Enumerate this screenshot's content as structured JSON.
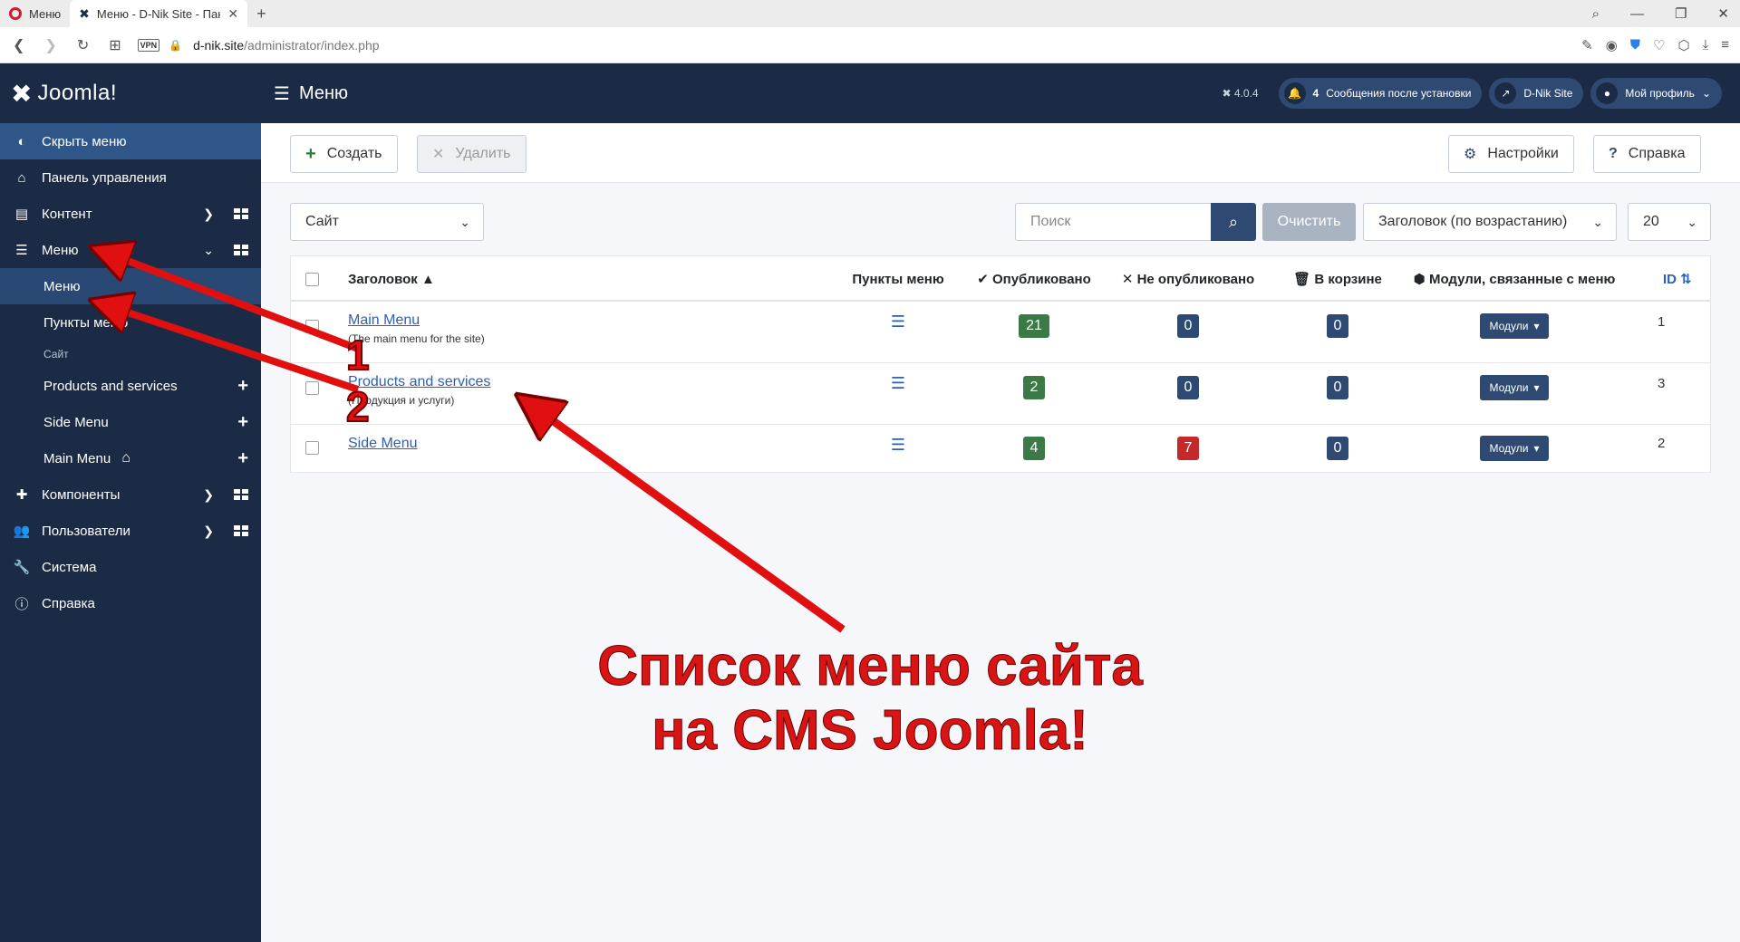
{
  "browser": {
    "tabs": [
      {
        "label": "Меню",
        "icon": "opera-icon"
      },
      {
        "label": "Меню - D-Nik Site - Панель",
        "icon": "joomla-icon"
      }
    ],
    "url_host": "d-nik.site",
    "url_path": "/administrator/index.php",
    "vpn_label": "VPN"
  },
  "sidebar": {
    "logo": "Joomla!",
    "hide_menu": "Скрыть меню",
    "items": [
      {
        "label": "Панель управления"
      },
      {
        "label": "Контент"
      },
      {
        "label": "Меню"
      }
    ],
    "menu_sub": [
      {
        "label": "Меню"
      },
      {
        "label": "Пункты меню"
      }
    ],
    "group_label": "Сайт",
    "site_menus": [
      {
        "label": "Products and services"
      },
      {
        "label": "Side Menu"
      },
      {
        "label": "Main Menu"
      }
    ],
    "items_bottom": [
      {
        "label": "Компоненты"
      },
      {
        "label": "Пользователи"
      },
      {
        "label": "Система"
      },
      {
        "label": "Справка"
      }
    ]
  },
  "header": {
    "title": "Меню",
    "version": "4.0.4",
    "notifications_count": "4",
    "notifications_label": "Сообщения после установки",
    "site_label": "D-Nik Site",
    "profile_label": "Мой профиль"
  },
  "toolbar": {
    "create": "Создать",
    "delete": "Удалить",
    "settings": "Настройки",
    "help": "Справка"
  },
  "filters": {
    "client": "Сайт",
    "search_placeholder": "Поиск",
    "clear": "Очистить",
    "sort": "Заголовок (по возрастанию)",
    "limit": "20"
  },
  "table": {
    "headers": {
      "title": "Заголовок",
      "items": "Пункты меню",
      "published": "Опубликовано",
      "unpublished": "Не опубликовано",
      "trashed": "В корзине",
      "modules": "Модули, связанные с меню",
      "id": "ID"
    },
    "rows": [
      {
        "title": "Main Menu",
        "note": "(The main menu for the site)",
        "published": "21",
        "unpublished": "0",
        "trashed": "0",
        "modules": "Модули",
        "id": "1"
      },
      {
        "title": "Products and services",
        "note": "(Продукция и услуги)",
        "published": "2",
        "unpublished": "0",
        "trashed": "0",
        "modules": "Модули",
        "id": "3"
      },
      {
        "title": "Side Menu",
        "note": "",
        "published": "4",
        "unpublished": "7",
        "trashed": "0",
        "modules": "Модули",
        "id": "2"
      }
    ]
  },
  "annotation": {
    "num1": "1",
    "num2": "2",
    "text_line1": "Список меню сайта",
    "text_line2": "на CMS Joomla!",
    "color": "#e01010"
  }
}
